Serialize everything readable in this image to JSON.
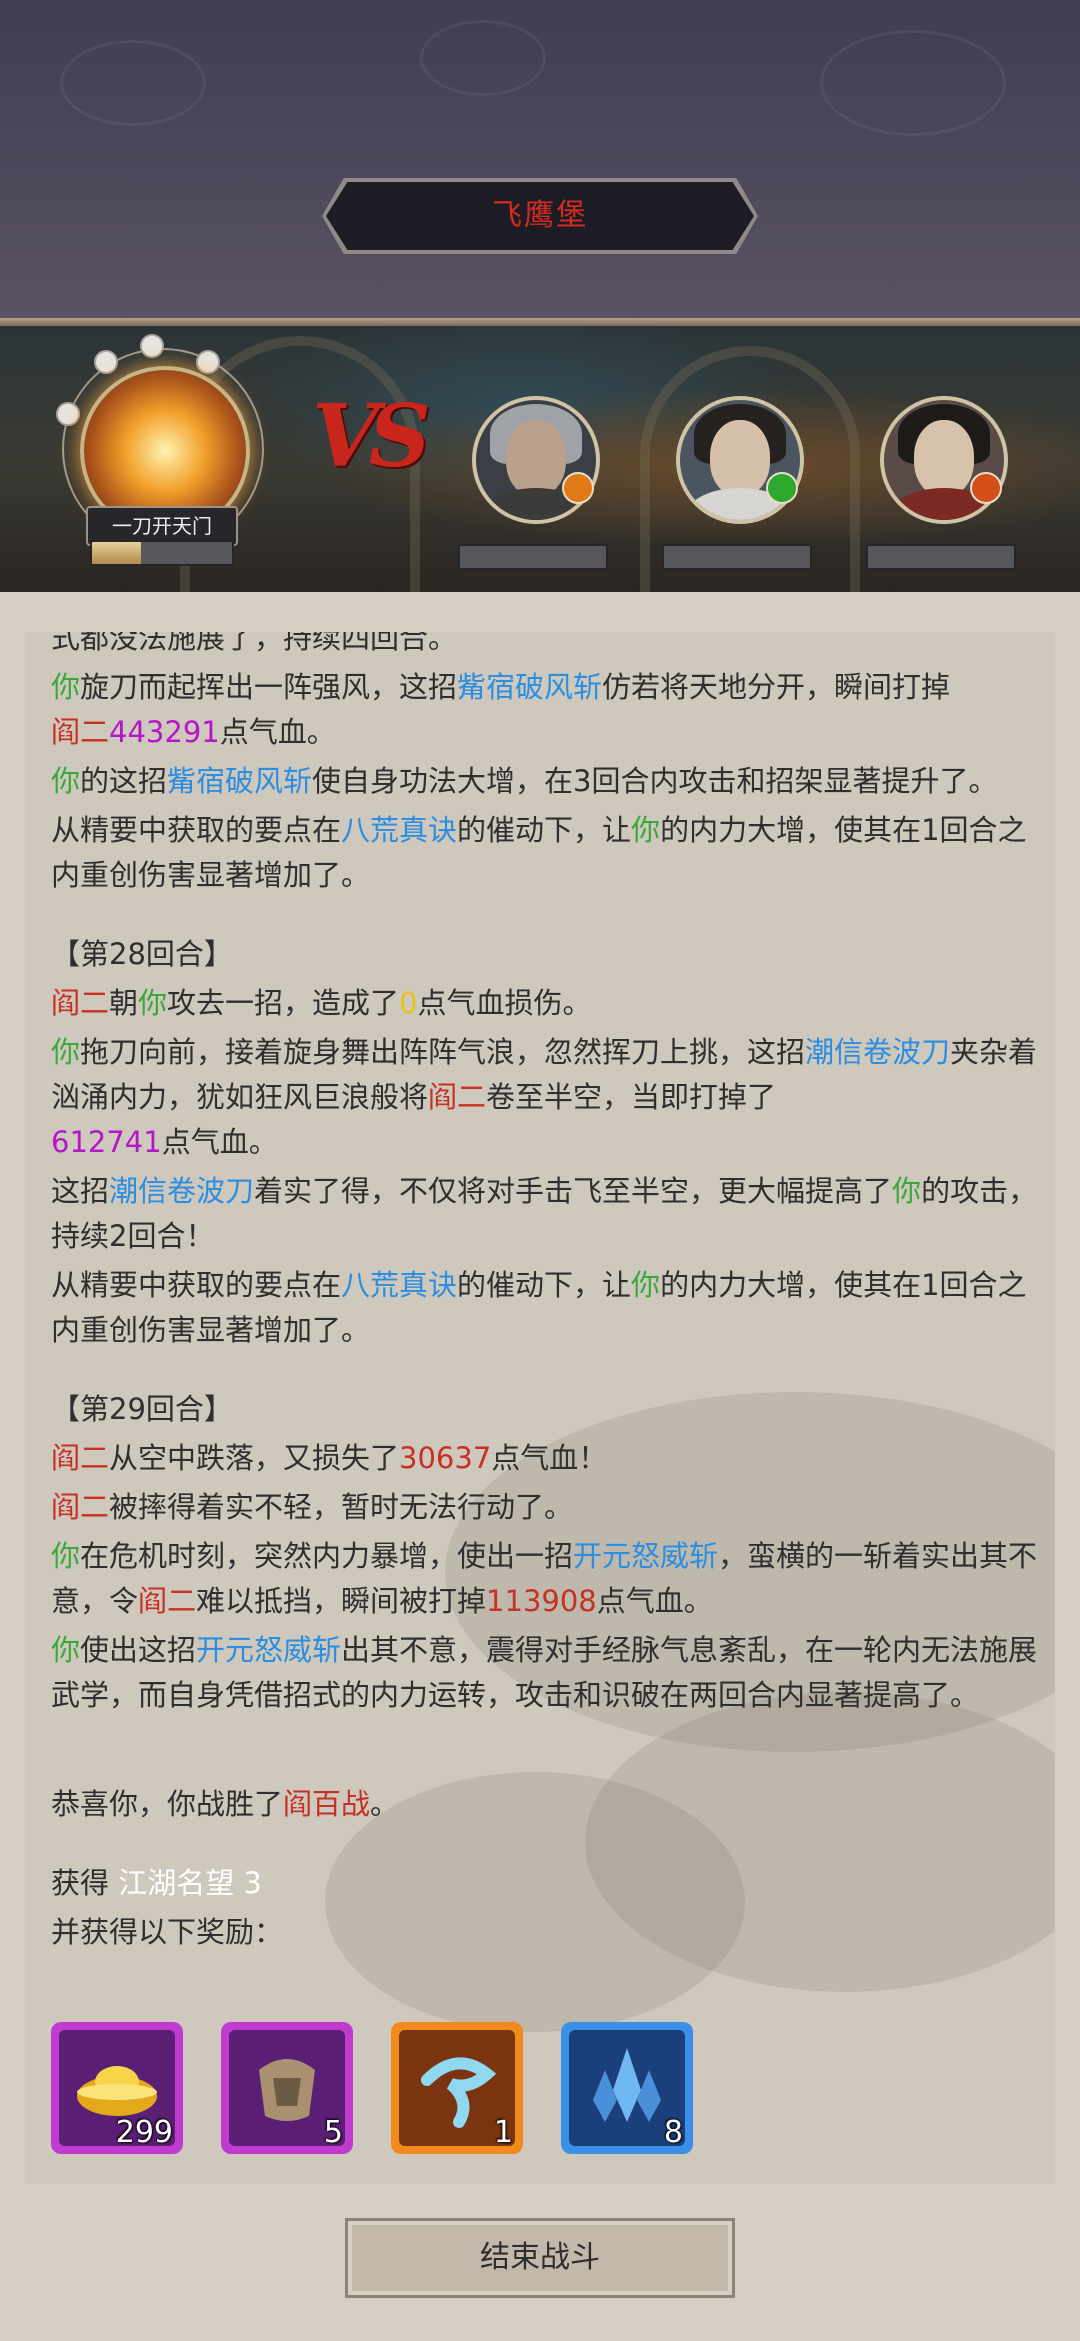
{
  "header": {
    "location_title": "飞鹰堡"
  },
  "battle": {
    "player": {
      "skill_label": "一刀开天门",
      "hp_fill": 0.35
    },
    "vs_text": "VS",
    "enemies": [
      {
        "icon": "fire-badge-icon",
        "badge_color": "#e07a16"
      },
      {
        "icon": "sword-badge-icon",
        "badge_color": "#2ea82e"
      },
      {
        "icon": "fire-badge-icon",
        "badge_color": "#d4501a"
      }
    ]
  },
  "log": {
    "line0": "式都没法施展了，持续四回合。",
    "l1": {
      "a": "你",
      "b": "旋刀而起挥出一阵强风，这招",
      "c": "觜宿破风斩",
      "d": "仿若将天地分开，瞬间打掉",
      "e": "阎二",
      "f": "443291",
      "g": "点气血。"
    },
    "l2": {
      "a": "你",
      "b": "的这招",
      "c": "觜宿破风斩",
      "d": "使自身功法大增，在3回合内攻击和招架显著提升了。"
    },
    "l3": {
      "a": "从精要中获取的要点在",
      "b": "八荒真诀",
      "c": "的催动下，让",
      "d": "你",
      "e": "的内力大增，使其在1回合之内重创伤害显著增加了。"
    },
    "round28": "【第28回合】",
    "l4": {
      "a": "阎二",
      "b": "朝",
      "c": "你",
      "d": "攻去一招，造成了",
      "e": "0",
      "f": "点气血损伤。"
    },
    "l5": {
      "a": "你",
      "b": "拖刀向前，接着旋身舞出阵阵气浪，忽然挥刀上挑，这招",
      "c": "潮信卷波刀",
      "d": "夹杂着汹涌内力，犹如狂风巨浪般将",
      "e": "阎二",
      "f": "卷至半空，当即打掉了",
      "g": "612741",
      "h": "点气血。"
    },
    "l6": {
      "a": "这招",
      "b": "潮信卷波刀",
      "c": "着实了得，不仅将对手击飞至半空，更大幅提高了",
      "d": "你",
      "e": "的攻击，持续2回合！"
    },
    "l7": {
      "a": "从精要中获取的要点在",
      "b": "八荒真诀",
      "c": "的催动下，让",
      "d": "你",
      "e": "的内力大增，使其在1回合之内重创伤害显著增加了。"
    },
    "round29": "【第29回合】",
    "l8": {
      "a": "阎二",
      "b": "从空中跌落，又损失了",
      "c": "30637",
      "d": "点气血！"
    },
    "l9": {
      "a": "阎二",
      "b": "被摔得着实不轻，暂时无法行动了。"
    },
    "l10": {
      "a": "你",
      "b": "在危机时刻，突然内力暴增，使出一招",
      "c": "开元怒威斩",
      "d": "，蛮横的一斩着实出其不意，令",
      "e": "阎二",
      "f": "难以抵挡，瞬间被打掉",
      "g": "113908",
      "h": "点气血。"
    },
    "l11": {
      "a": "你",
      "b": "使出这招",
      "c": "开元怒威斩",
      "d": "出其不意，震得对手经脉气息紊乱，在一轮内无法施展武学，而自身凭借招式的内力运转，攻击和识破在两回合内显著提高了。"
    },
    "victory": {
      "a": "恭喜你，你战胜了",
      "b": "阎百战",
      "c": "。"
    },
    "gain": {
      "a": "获得 ",
      "b": "江湖名望 3"
    },
    "rewards_title": "并获得以下奖励："
  },
  "rewards": [
    {
      "name": "gold-ingot-icon",
      "count": "299",
      "frame": "#c23bd1",
      "bg": "#5a1f74"
    },
    {
      "name": "token-icon",
      "count": "5",
      "frame": "#c23bd1",
      "bg": "#5a1f74"
    },
    {
      "name": "blue-swirl-icon",
      "count": "1",
      "frame": "#f08a1c",
      "bg": "#7a3410"
    },
    {
      "name": "crystal-icon",
      "count": "8",
      "frame": "#3a8fe6",
      "bg": "#1b3f7a"
    }
  ],
  "footer": {
    "end_button": "结束战斗"
  }
}
